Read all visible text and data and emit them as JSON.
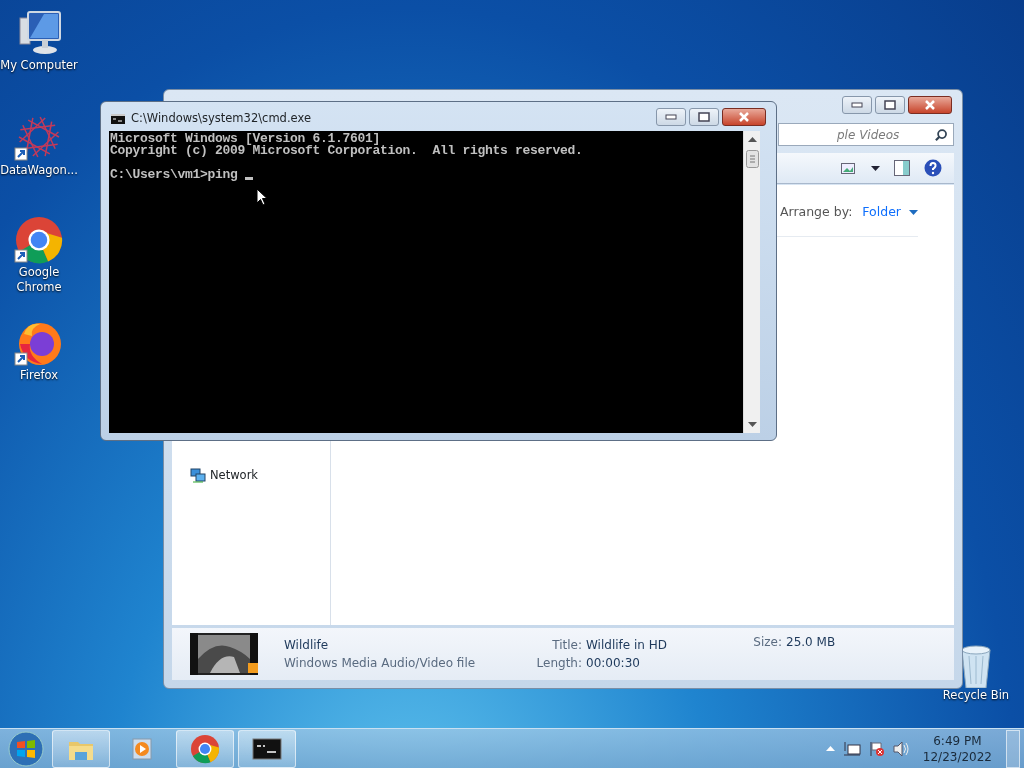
{
  "desktop_icons": [
    {
      "kind": "computer",
      "label": "My Computer"
    },
    {
      "kind": "datawagon",
      "label": "DataWagon..."
    },
    {
      "kind": "chrome",
      "label": "Google Chrome"
    },
    {
      "kind": "firefox",
      "label": "Firefox"
    },
    {
      "kind": "recycle",
      "label": "Recycle Bin"
    }
  ],
  "explorer": {
    "search": {
      "placeholder": "ple Videos"
    },
    "arrange_label": "Arrange by:",
    "arrange_value": "Folder",
    "nav_items": [
      {
        "label": "Network"
      }
    ],
    "details": {
      "name": "Wildlife",
      "type": "Windows Media Audio/Video file",
      "fields": [
        {
          "label": "Title:",
          "value": "Wildlife in HD"
        },
        {
          "label": "Length:",
          "value": "00:00:30"
        },
        {
          "label": "Size:",
          "value": "25.0 MB"
        }
      ]
    }
  },
  "console": {
    "title": "C:\\Windows\\system32\\cmd.exe",
    "lines": [
      "Microsoft Windows [Version 6.1.7601]",
      "Copyright (c) 2009 Microsoft Corporation.  All rights reserved."
    ],
    "prompt": "C:\\Users\\vm1>ping "
  },
  "taskbar": {
    "items": [
      {
        "kind": "explorer",
        "running": true
      },
      {
        "kind": "media",
        "running": false
      },
      {
        "kind": "chrome",
        "running": true
      },
      {
        "kind": "cmd",
        "running": true
      }
    ],
    "tray": {
      "time": "6:49 PM",
      "date": "12/23/2022"
    }
  }
}
